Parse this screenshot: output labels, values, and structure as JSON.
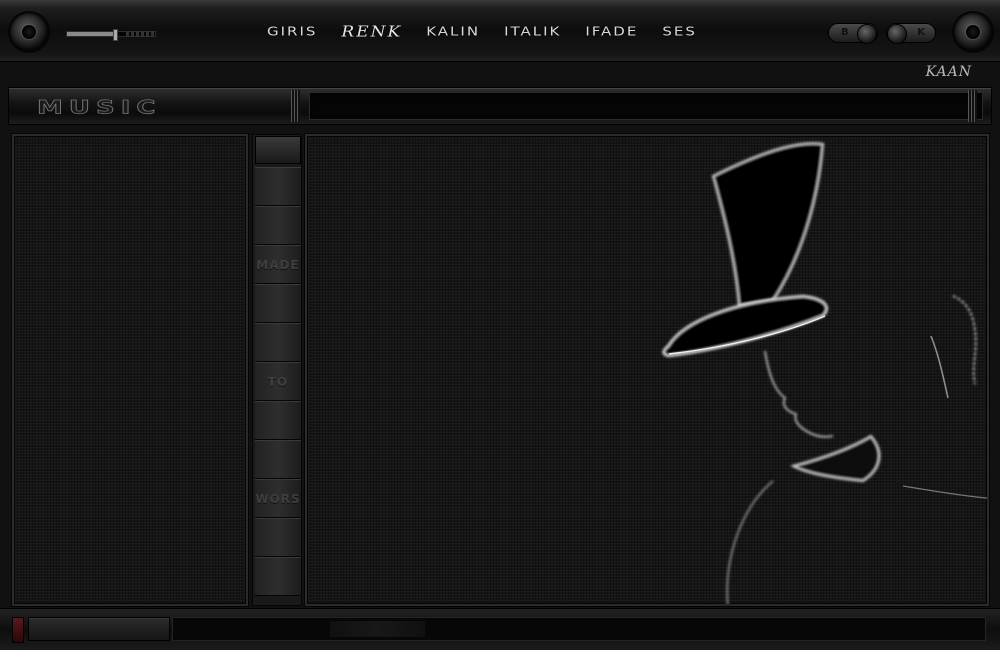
{
  "topbar": {
    "menu": [
      {
        "label": "GIRIS",
        "style": "plain"
      },
      {
        "label": "Renk",
        "style": "script"
      },
      {
        "label": "KALIN",
        "style": "plain"
      },
      {
        "label": "ITALIK",
        "style": "plain"
      },
      {
        "label": "IFADE",
        "style": "plain"
      },
      {
        "label": "SES",
        "style": "plain"
      }
    ],
    "toggle_b_label": "B",
    "toggle_k_label": "K",
    "volume_level": 0.55
  },
  "brand": "KAAN",
  "titlebar": {
    "site_title": "MUSIC"
  },
  "mid_column": {
    "segments": [
      "",
      "",
      "MADE",
      "",
      "",
      "TO",
      "",
      "",
      "WORS",
      "",
      ""
    ]
  },
  "colors": {
    "background": "#0a0a0a",
    "panel": "#151515",
    "text": "#d8d8d8",
    "accent_led": "#5a1a1a"
  },
  "icons": {
    "left_knob": "dial-knob-icon",
    "right_knob": "dial-knob-icon"
  }
}
